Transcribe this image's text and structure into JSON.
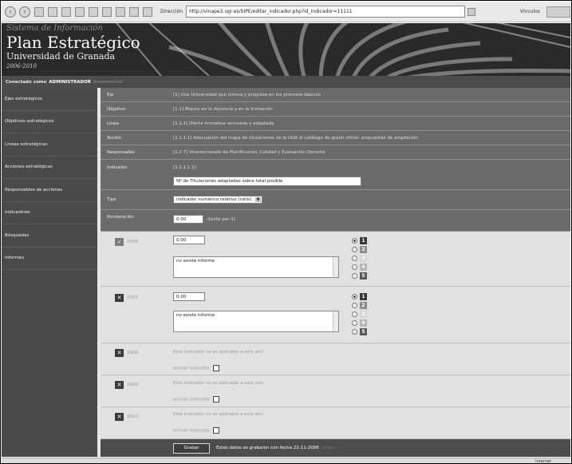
{
  "browser": {
    "address_label": "Dirección",
    "url": "http://vinape3.ugr.es/SIPE/editar_indicador.php?id_indicador=11111",
    "links_label": "Vínculos",
    "status_zone": "Internet"
  },
  "header": {
    "system_name": "Sistema de Información",
    "title": "Plan Estratégico",
    "subtitle": "Universidad de Granada",
    "years": "2006-2010"
  },
  "userbar": {
    "connected_label": "Conectado como",
    "user": "ADMINISTRADOR",
    "logout": "desconectar"
  },
  "sidebar": {
    "items": [
      {
        "label": "Ejes estratégicos"
      },
      {
        "label": "Objetivos estratégicos"
      },
      {
        "label": "Líneas estratégicas"
      },
      {
        "label": "Acciones estratégicas"
      },
      {
        "label": "Responsables de acciones"
      },
      {
        "label": "Indicadores"
      },
      {
        "label": "Búsquedas"
      },
      {
        "label": "Informes"
      }
    ]
  },
  "form": {
    "eje": {
      "label": "Eje",
      "value": "[1] Una Universidad que innova y progresa en los procesos básicos"
    },
    "objetivo": {
      "label": "Objetivo",
      "value": "[1.1] Mejora en la docencia y en la formación"
    },
    "linea": {
      "label": "Línea",
      "value": "[1.1.1] Oferta formativa renovada y adaptada"
    },
    "accion": {
      "label": "Acción",
      "value": "[1.1.1.1] Adecuación del mapa de titulaciones de la UGR al catálogo de grado oficial: propuestas de ampliación"
    },
    "responsable": {
      "label": "Responsable",
      "value": "[1.2.7] Vicerrectorado de Planificación, Calidad y Evaluación Docente"
    },
    "indicador": {
      "label": "Indicador",
      "code": "[1.1.1.1.1]",
      "value": "Nº de Titulaciones adaptadas sobre total posible"
    },
    "tipo": {
      "label": "Tipo",
      "value": "indicador numérico relativo (ratio)"
    },
    "ponderacion": {
      "label": "Ponderación",
      "value": "0.00",
      "note": "(tanto por 1)"
    }
  },
  "years": [
    {
      "year": "2006",
      "checked": true,
      "value": "0.00",
      "report": "no existe informe",
      "levels": [
        "1",
        "2",
        "3",
        "4",
        "5"
      ],
      "selected_level": 1
    },
    {
      "year": "2007",
      "checked": false,
      "value": "0.00",
      "report": "no existe informe",
      "levels": [
        "1",
        "2",
        "3",
        "4",
        "5"
      ],
      "selected_level": 1
    },
    {
      "year": "2008",
      "checked": false,
      "not_applicable": "Este indicador no es aplicable a este año",
      "activate_label": "activar indicador"
    },
    {
      "year": "2009",
      "checked": false,
      "not_applicable": "Este indicador no es aplicable a este año",
      "activate_label": "activar indicador"
    },
    {
      "year": "2010",
      "checked": false,
      "not_applicable": "Este indicador no es aplicable a este año",
      "activate_label": "activar indicador"
    }
  ],
  "footer": {
    "save_label": "Grabar",
    "saved_note": "Estos datos se grabaron con fecha 22-11-2006",
    "back_label": "volver"
  },
  "colors": {
    "level_1": "#3a3a3a",
    "level_2": "#8c8c8c",
    "level_3": "#d8d8d8",
    "level_4": "#b5b5b5",
    "level_5": "#5a5a5a"
  }
}
